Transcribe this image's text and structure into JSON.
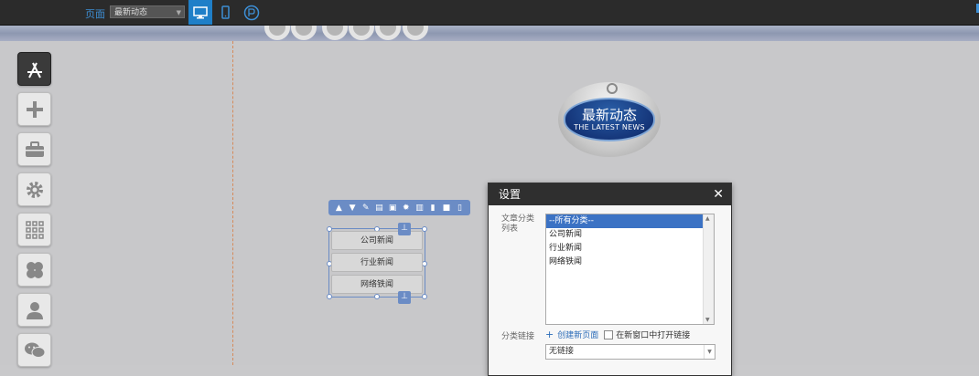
{
  "topbar": {
    "page_label": "页面",
    "page_select": "最新动态",
    "devices": [
      "desktop-icon",
      "mobile-icon",
      "wp-icon"
    ]
  },
  "tools": [
    "app-store-icon",
    "plus-icon",
    "briefcase-icon",
    "gear-icon",
    "grid-icon",
    "four-leaf-icon",
    "user-icon",
    "wechat-icon"
  ],
  "badge": {
    "title": "最新动态",
    "subtitle": "THE LATEST NEWS"
  },
  "edit_toolbar": [
    "chevron-up-icon",
    "chevron-down-icon",
    "edit-icon",
    "layout-icon",
    "link-page-icon",
    "gear-icon",
    "columns-icon",
    "chart-icon",
    "lock-icon",
    "trash-icon"
  ],
  "module": {
    "buttons": [
      "公司新闻",
      "行业新闻",
      "网络铁闻"
    ]
  },
  "dialog": {
    "title": "设置",
    "category_label": "文章分类列表",
    "categories": [
      "--所有分类--",
      "公司新闻",
      "行业新闻",
      "网络铁闻"
    ],
    "selected_category": "--所有分类--",
    "link_label": "分类链接",
    "create_link": "创建新页面",
    "new_window_label": "在新窗口中打开链接",
    "link_value": "无链接"
  },
  "colors": {
    "accent": "#1f7fc8",
    "selection": "#6b8cc5",
    "list_selected": "#3b72c4"
  }
}
